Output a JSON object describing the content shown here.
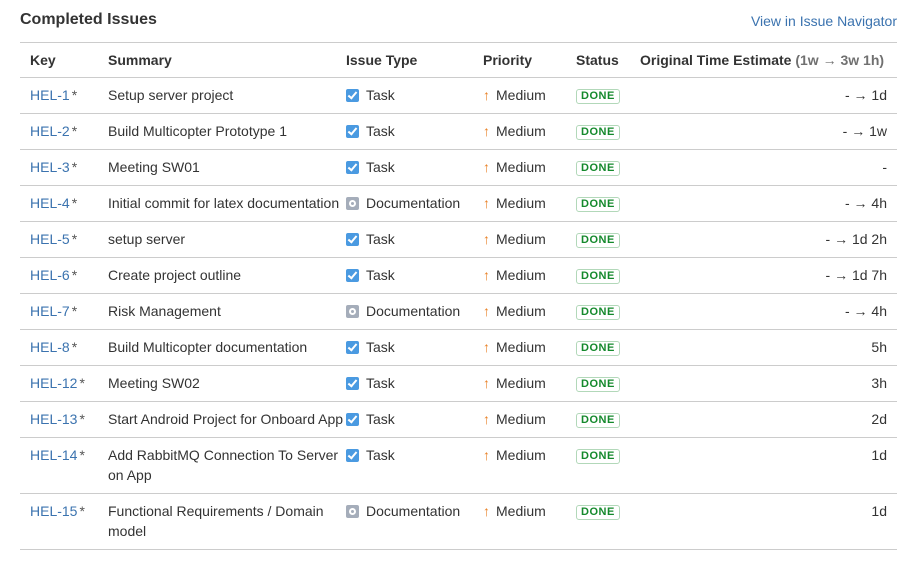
{
  "header": {
    "title": "Completed Issues",
    "navigator_link": "View in Issue Navigator"
  },
  "columns": {
    "key": "Key",
    "summary": "Summary",
    "type": "Issue Type",
    "priority": "Priority",
    "status": "Status",
    "estimate": "Original Time Estimate",
    "estimate_range": "(1w → 3w 1h)"
  },
  "colors": {
    "link": "#3b73af",
    "done": "#14892c",
    "priority_medium": "#e98125",
    "task_icon": "#4a9ae1",
    "doc_icon": "#a5adba"
  },
  "issues": [
    {
      "key": "HEL-1",
      "flag": "*",
      "summary": "Setup server project",
      "type": "Task",
      "type_icon": "task-icon",
      "priority": "Medium",
      "status": "DONE",
      "estimate": "- → 1d"
    },
    {
      "key": "HEL-2",
      "flag": "*",
      "summary": "Build Multicopter Prototype 1",
      "type": "Task",
      "type_icon": "task-icon",
      "priority": "Medium",
      "status": "DONE",
      "estimate": "- → 1w"
    },
    {
      "key": "HEL-3",
      "flag": "*",
      "summary": "Meeting SW01",
      "type": "Task",
      "type_icon": "task-icon",
      "priority": "Medium",
      "status": "DONE",
      "estimate": "-"
    },
    {
      "key": "HEL-4",
      "flag": "*",
      "summary": "Initial commit for latex documentation",
      "type": "Documentation",
      "type_icon": "documentation-icon",
      "priority": "Medium",
      "status": "DONE",
      "estimate": "- → 4h"
    },
    {
      "key": "HEL-5",
      "flag": "*",
      "summary": "setup server",
      "type": "Task",
      "type_icon": "task-icon",
      "priority": "Medium",
      "status": "DONE",
      "estimate": "- → 1d 2h"
    },
    {
      "key": "HEL-6",
      "flag": "*",
      "summary": "Create project outline",
      "type": "Task",
      "type_icon": "task-icon",
      "priority": "Medium",
      "status": "DONE",
      "estimate": "- → 1d 7h"
    },
    {
      "key": "HEL-7",
      "flag": "*",
      "summary": "Risk Management",
      "type": "Documentation",
      "type_icon": "documentation-icon",
      "priority": "Medium",
      "status": "DONE",
      "estimate": "- → 4h"
    },
    {
      "key": "HEL-8",
      "flag": "*",
      "summary": "Build Multicopter documentation",
      "type": "Task",
      "type_icon": "task-icon",
      "priority": "Medium",
      "status": "DONE",
      "estimate": "5h"
    },
    {
      "key": "HEL-12",
      "flag": "*",
      "summary": "Meeting SW02",
      "type": "Task",
      "type_icon": "task-icon",
      "priority": "Medium",
      "status": "DONE",
      "estimate": "3h"
    },
    {
      "key": "HEL-13",
      "flag": "*",
      "summary": "Start Android Project for Onboard App",
      "type": "Task",
      "type_icon": "task-icon",
      "priority": "Medium",
      "status": "DONE",
      "estimate": "2d"
    },
    {
      "key": "HEL-14",
      "flag": "*",
      "summary": "Add RabbitMQ Connection To Server on App",
      "type": "Task",
      "type_icon": "task-icon",
      "priority": "Medium",
      "status": "DONE",
      "estimate": "1d"
    },
    {
      "key": "HEL-15",
      "flag": "*",
      "summary": "Functional Requirements / Domain model",
      "type": "Documentation",
      "type_icon": "documentation-icon",
      "priority": "Medium",
      "status": "DONE",
      "estimate": "1d"
    }
  ]
}
